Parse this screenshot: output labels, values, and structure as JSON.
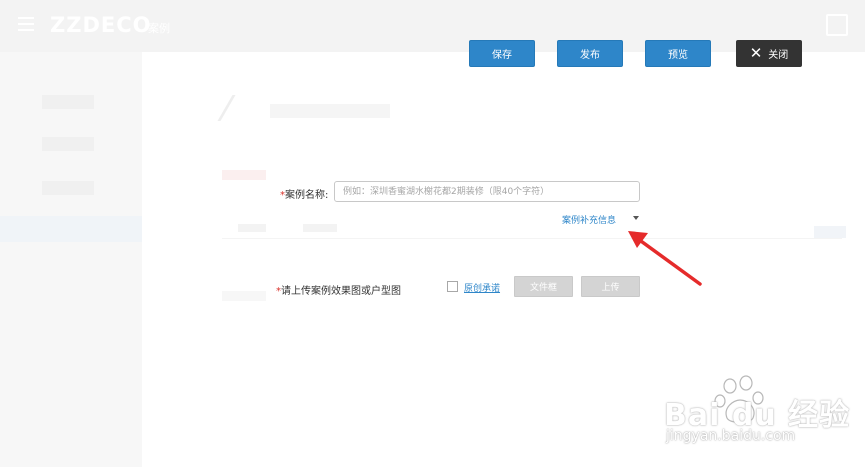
{
  "app": {
    "logo": "ZZDECO",
    "logo_sub": "案例"
  },
  "toolbar": {
    "save_label": "保存",
    "publish_label": "发布",
    "preview_label": "预览",
    "close_label": "关闭"
  },
  "form": {
    "case_name": {
      "required_mark": "*",
      "label": "案例名称:",
      "value": "",
      "placeholder": "例如：深圳香蜜湖水榭花都2期装修（限40个字符）"
    },
    "supplement_link": "案例补充信息",
    "upload": {
      "required_mark": "*",
      "label": "请上传案例效果图或户型图",
      "terms_checked": false,
      "terms_label": "原创承诺",
      "file_button": "文件框",
      "upload_button": "上传"
    }
  },
  "watermark": {
    "text": "Bai du 经验",
    "url": "jingyan.baidu.com"
  },
  "colors": {
    "accent": "#2e86c9",
    "close_bg": "#333333",
    "required": "#d9312b",
    "annotation_arrow": "#e52b2b"
  }
}
